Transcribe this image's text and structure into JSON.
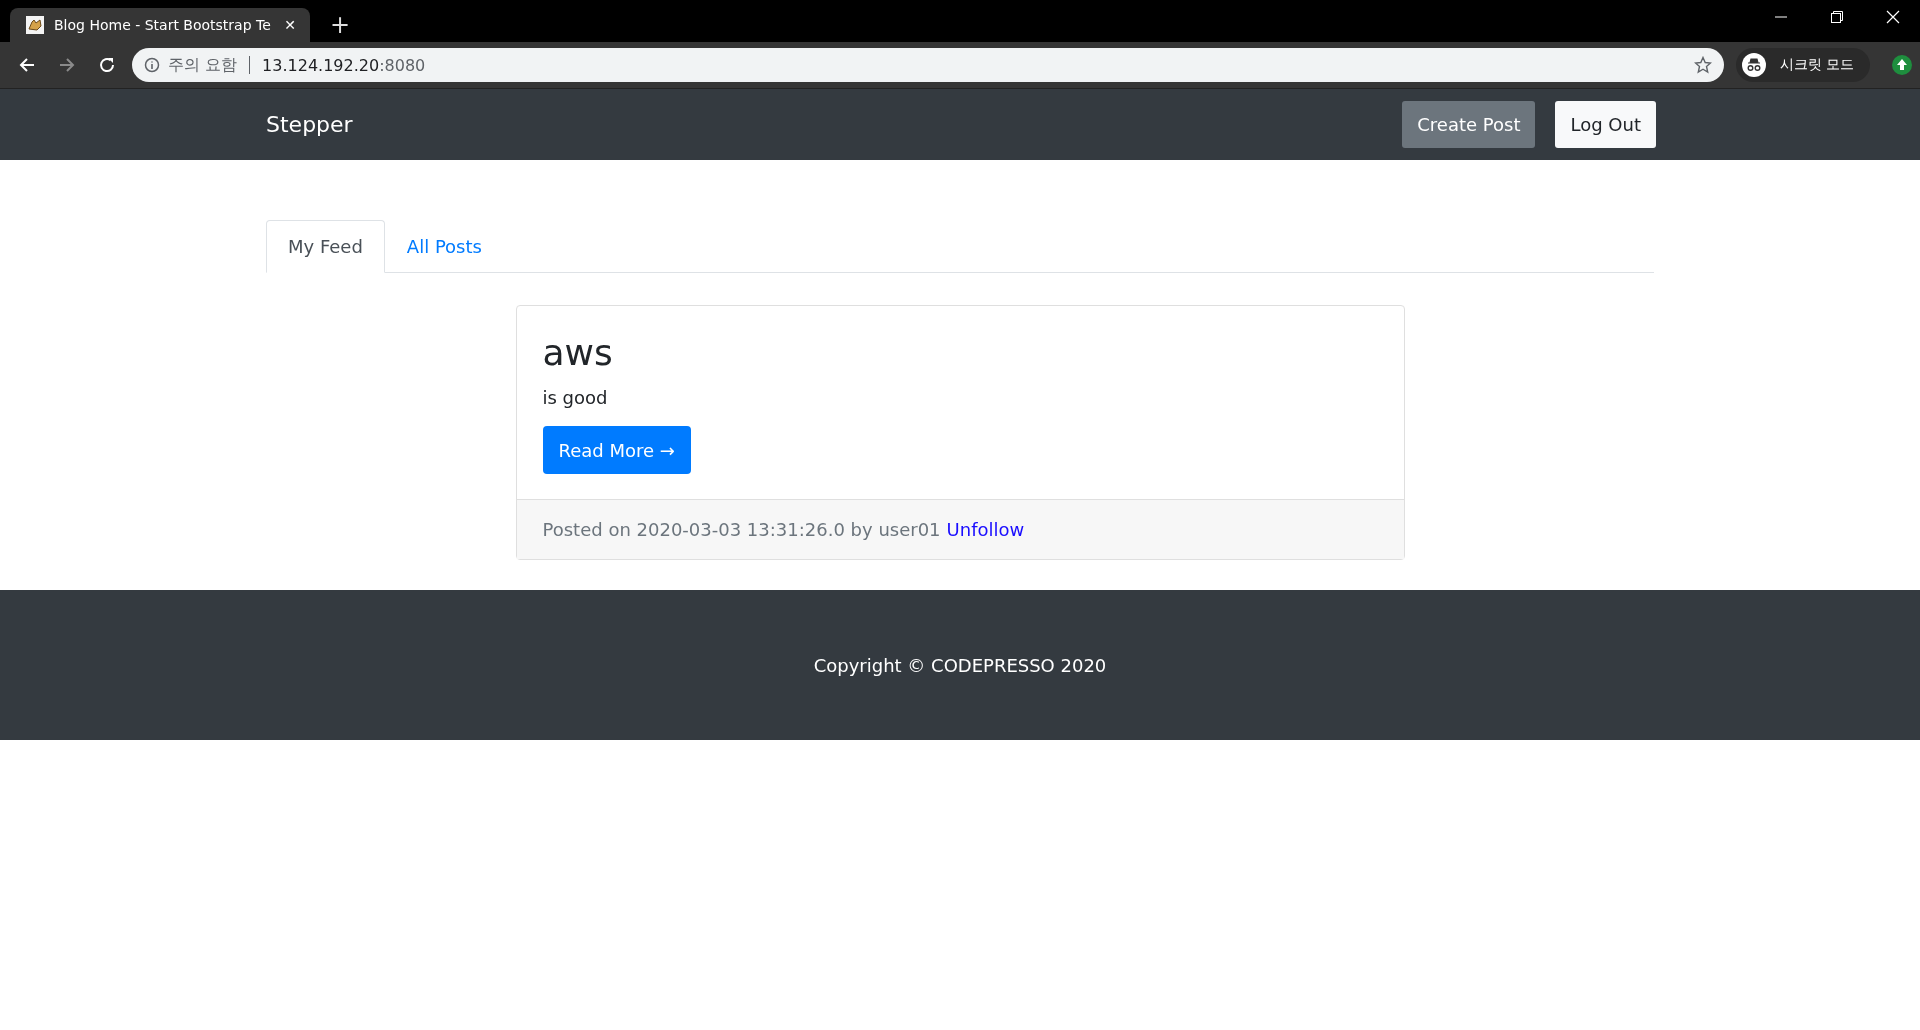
{
  "browser": {
    "tab_title": "Blog Home - Start Bootstrap Te",
    "tab_close": "✕",
    "new_tab": "+",
    "security_label": "주의 요함",
    "url_host": "13.124.192.20",
    "url_port": ":8080",
    "incognito_label": "시크릿 모드"
  },
  "navbar": {
    "brand": "Stepper",
    "buttons": [
      {
        "label": "Create Post",
        "kind": "secondary"
      },
      {
        "label": "Log Out",
        "kind": "light"
      }
    ]
  },
  "tabs": [
    {
      "label": "My Feed",
      "selected": true
    },
    {
      "label": "All Posts",
      "selected": false
    }
  ],
  "posts": [
    {
      "title": "aws",
      "body": "is good",
      "button": "Read More →",
      "footer": "Posted on 2020-03-03 13:31:26.0 by user01",
      "link": "Unfollow"
    }
  ],
  "footer": {
    "copyright": "Copyright © CODEPRESSO 2020"
  }
}
